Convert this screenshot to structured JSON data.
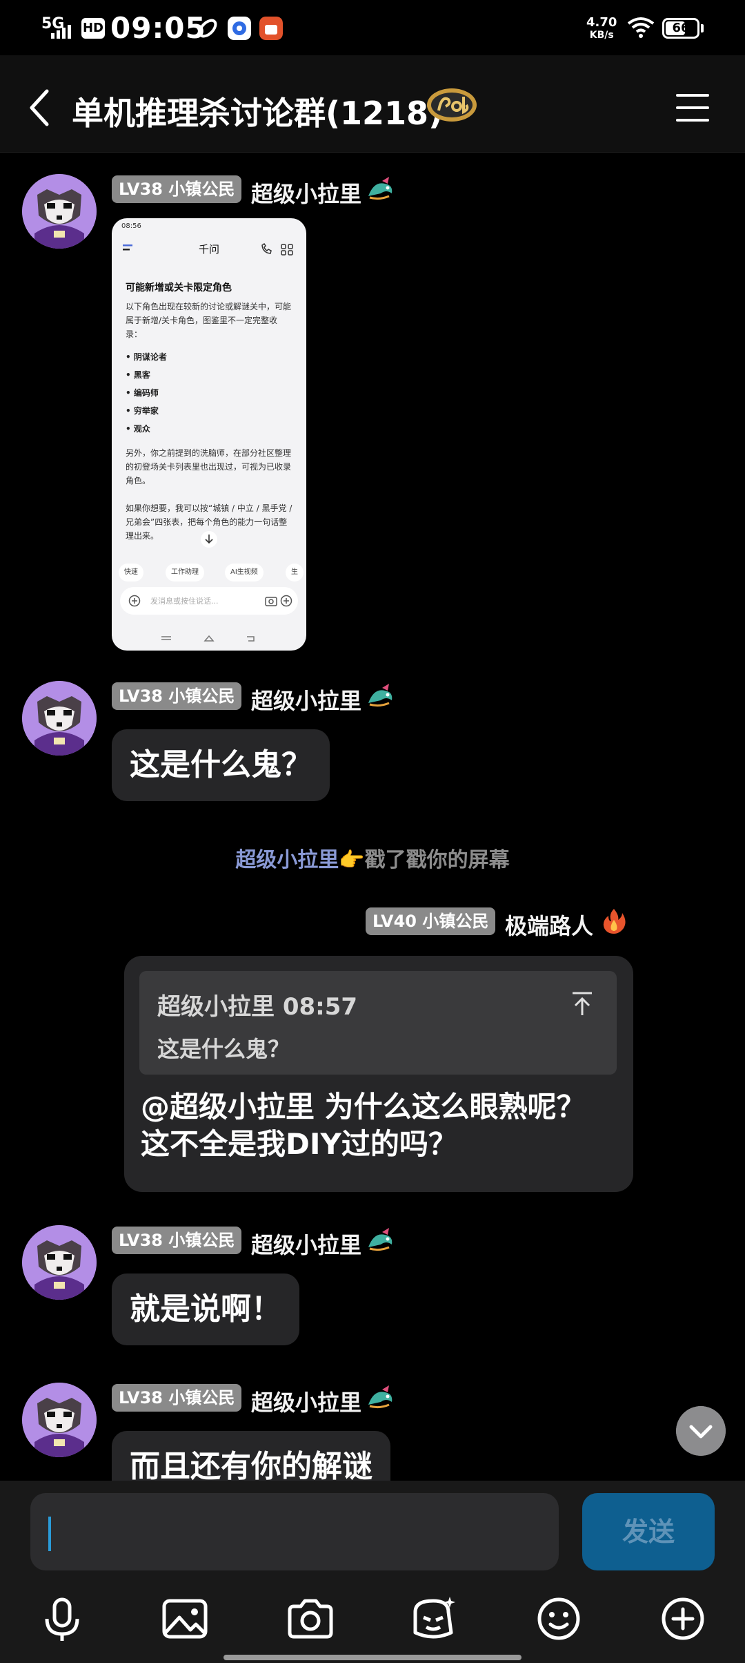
{
  "status_bar": {
    "network": "5G",
    "hd": "HD",
    "time": "09:05",
    "speed_value": "4.70",
    "speed_unit": "KB/s",
    "battery": "66",
    "battery_level": 0.66
  },
  "header": {
    "title": "单机推理杀讨论群(1218)",
    "badge_icon": "group-badge-icon",
    "back_icon": "chevron-left-icon",
    "menu_icon": "menu-icon"
  },
  "messages": [
    {
      "level": "LV38 小镇公民",
      "nick": "超级小拉里",
      "type": "image",
      "image": {
        "status_time": "08:56",
        "app_title": "千问",
        "heading": "可能新增或关卡限定角色",
        "intro": "以下角色出现在较新的讨论或解谜关中，可能属于新增/关卡角色，图鉴里不一定完整收录：",
        "items": [
          "阴谋论者",
          "黑客",
          "编码师",
          "穷举家",
          "观众"
        ],
        "para1": "另外，你之前提到的洗脑师，在部分社区整理的初登场关卡列表里也出现过，可视为已收录角色。",
        "para2": "如果你想要，我可以按“城镇 / 中立 / 黑手党 / 兄弟会”四张表，把每个角色的能力一句话整理出来。",
        "chips": [
          "快速",
          "工作助理",
          "AI生视频",
          "生"
        ],
        "input_placeholder": "发消息或按住说话..."
      }
    },
    {
      "level": "LV38 小镇公民",
      "nick": "超级小拉里",
      "type": "text",
      "text": "这是什么鬼？"
    },
    {
      "level": "LV38 小镇公民",
      "nick": "超级小拉里",
      "type": "text",
      "text": "就是说啊！"
    },
    {
      "level": "LV38 小镇公民",
      "nick": "超级小拉里",
      "type": "text",
      "text": "而且还有你的解谜"
    }
  ],
  "system_message": {
    "actor": "超级小拉里",
    "emoji": "👉",
    "text": "戳了戳你的屏幕"
  },
  "reply_message": {
    "level": "LV40 小镇公民",
    "nick": "极端路人",
    "quote_header": "超级小拉里 08:57",
    "quote_text": "这是什么鬼？",
    "line1": "@超级小拉里 为什么这么眼熟呢？",
    "line2": "这不全是我DIY过的吗？"
  },
  "input": {
    "placeholder": "",
    "send_label": "发送"
  },
  "toolbar": [
    "microphone-icon",
    "image-icon",
    "camera-icon",
    "sticker-icon",
    "emoji-icon",
    "add-icon"
  ],
  "colors": {
    "background": "#000000",
    "bubble": "#262628",
    "level_tag": "#8a8a8a",
    "send_button": "#0e5f90",
    "avatar_bg": "#b38ee6",
    "system_actor": "#8a9ad6"
  }
}
